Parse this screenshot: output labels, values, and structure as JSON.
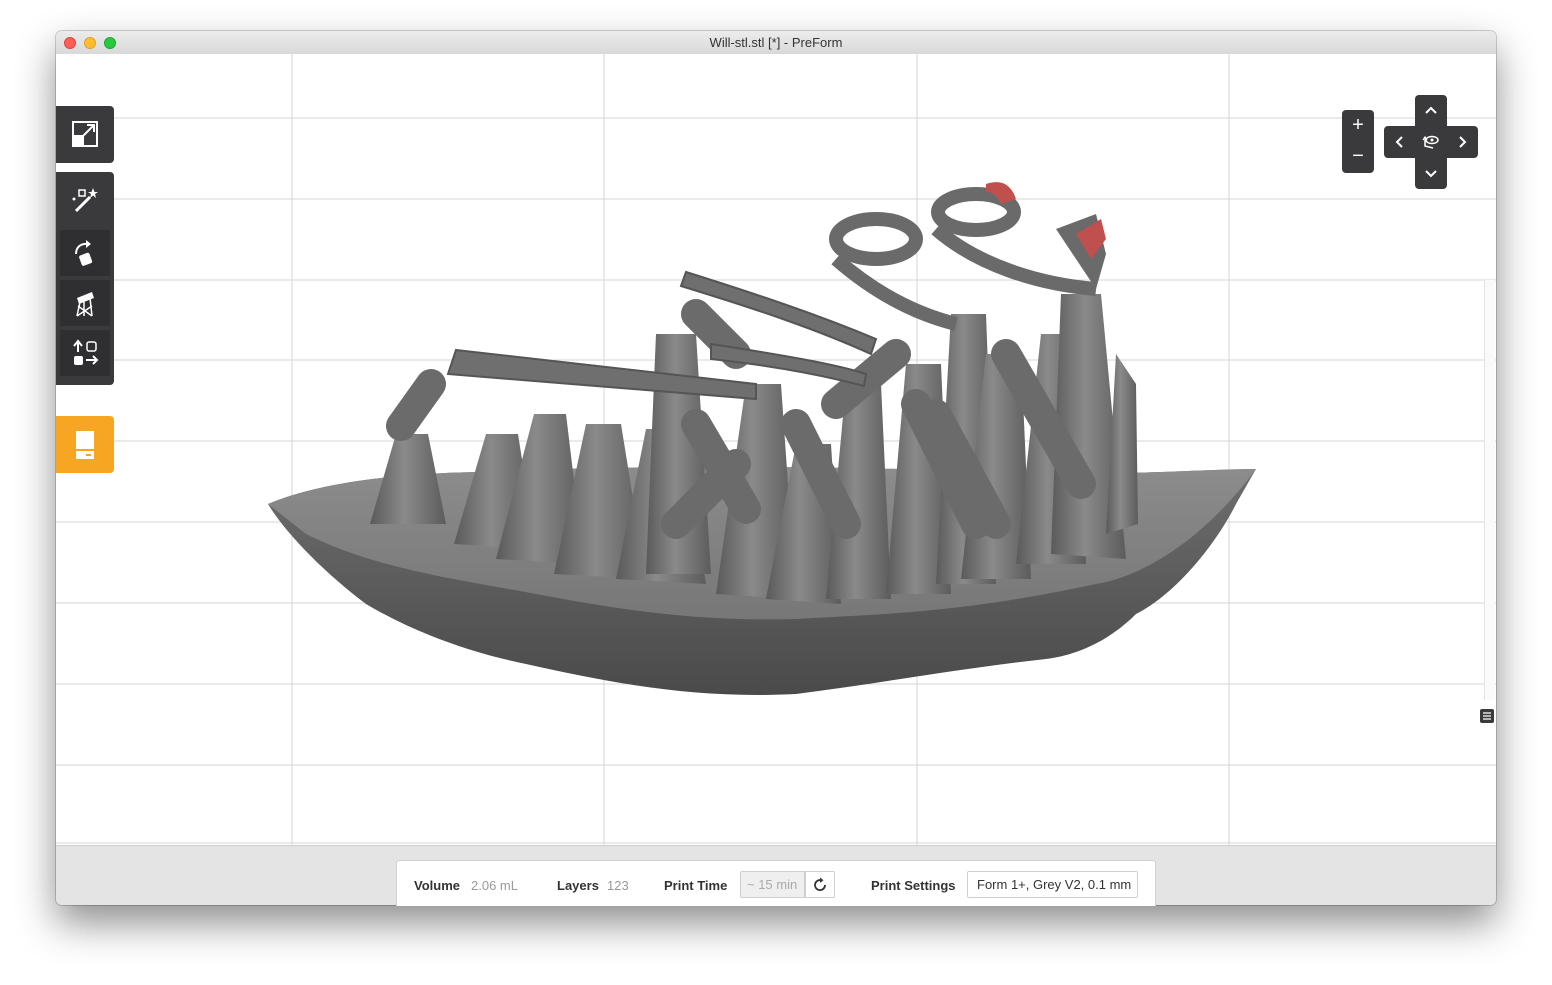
{
  "window": {
    "title": "Will-stl.stl [*] - PreForm"
  },
  "left_toolbar": {
    "top_tool": "scale-expand-icon",
    "tools": [
      "auto-support-magic-wand-icon",
      "rotate-icon",
      "supports-icon",
      "layout-icon"
    ],
    "print_tool": "print-icon",
    "print_accent": "#f6a623"
  },
  "camera_controls": {
    "zoom_in": "+",
    "zoom_out": "−",
    "up": "^",
    "down": "v",
    "left": "<",
    "right": ">",
    "center_icon": "eye-orbit-icon"
  },
  "status": {
    "volume_label": "Volume",
    "volume_value": "2.06 mL",
    "layers_label": "Layers",
    "layers_value": "123",
    "print_time_label": "Print Time",
    "print_time_value": "~ 15 min",
    "print_settings_label": "Print Settings",
    "print_settings_value": "Form 1+, Grey V2, 0.1 mm"
  },
  "colors": {
    "model": "#7a7a7a",
    "highlight": "#c0504d",
    "toolbar": "#3a3a3c"
  }
}
